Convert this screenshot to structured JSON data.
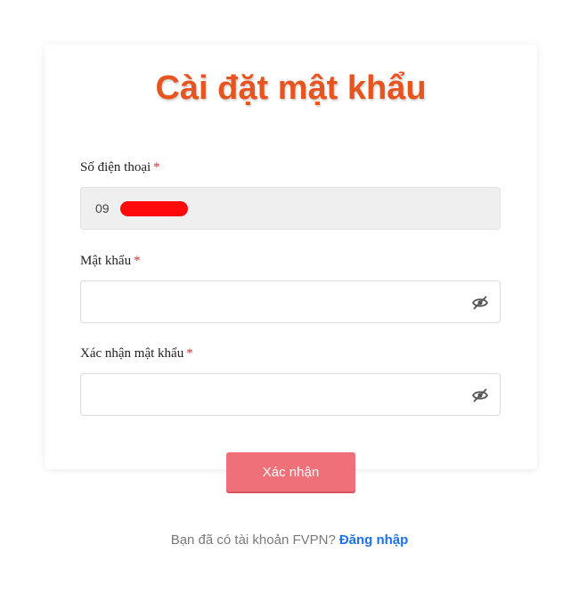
{
  "page": {
    "title": "Cài đặt mật khẩu"
  },
  "form": {
    "phone": {
      "label": "Số điện thoại",
      "required_mark": "*",
      "value": "09"
    },
    "password": {
      "label": "Mật khẩu",
      "required_mark": "*",
      "value": ""
    },
    "confirm_password": {
      "label": "Xác nhận mật khẩu",
      "required_mark": "*",
      "value": ""
    },
    "submit_label": "Xác nhận"
  },
  "footer": {
    "prompt": "Bạn đã có tài khoản FVPN?",
    "login_link": "Đăng nhập"
  },
  "icons": {
    "password_toggle": "eye-off-icon",
    "confirm_toggle": "eye-off-icon"
  },
  "colors": {
    "title": "#e8541f",
    "button": "#f0707a",
    "link": "#1a73e8",
    "required": "#d32f2f"
  }
}
